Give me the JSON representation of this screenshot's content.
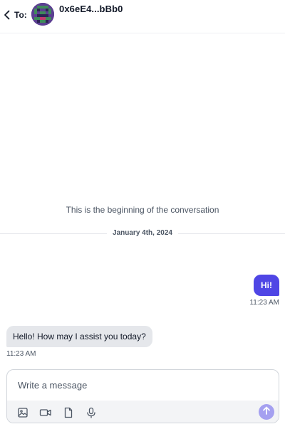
{
  "header": {
    "to_label": "To:",
    "recipient": "0x6eE4...bBb0",
    "avatar_icon": "identicon-avatar",
    "back_icon": "chevron-left-icon"
  },
  "conversation": {
    "beginning_text": "This is the beginning of the conversation",
    "date": "January 4th, 2024",
    "messages": [
      {
        "direction": "outgoing",
        "text": "Hi!",
        "time": "11:23 AM"
      },
      {
        "direction": "incoming",
        "text": "Hello! How may I assist you today?",
        "time": "11:23 AM"
      }
    ]
  },
  "composer": {
    "placeholder": "Write a message",
    "value": "",
    "tools": [
      "image-icon",
      "video-icon",
      "file-icon",
      "microphone-icon"
    ],
    "send_icon": "arrow-up-icon"
  },
  "colors": {
    "accent": "#4f46e5",
    "send_button": "#a5a0f0",
    "incoming_bubble": "#e5e7eb",
    "toolbar_bg": "#f3f4f6"
  }
}
